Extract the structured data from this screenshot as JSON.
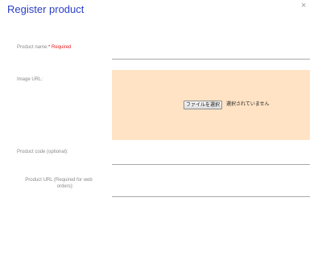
{
  "dialog": {
    "title": "Register product",
    "close_symbol": "×"
  },
  "fields": {
    "product_name": {
      "label": "Product name:",
      "required_marker": "* Required",
      "value": ""
    },
    "image_url": {
      "label": "Image URL:",
      "file_button": "ファイルを選択",
      "file_status": "選択されていません"
    },
    "product_code": {
      "label": "Product code (optional):",
      "value": ""
    },
    "product_url": {
      "label_line1": "Product URL (Required for web",
      "label_line2": "orders):",
      "value": ""
    }
  },
  "colors": {
    "title": "#2a3ec9",
    "required": "#e02020",
    "image_area_bg": "#ffe3c4"
  },
  "icons": {
    "close": "close-icon"
  }
}
